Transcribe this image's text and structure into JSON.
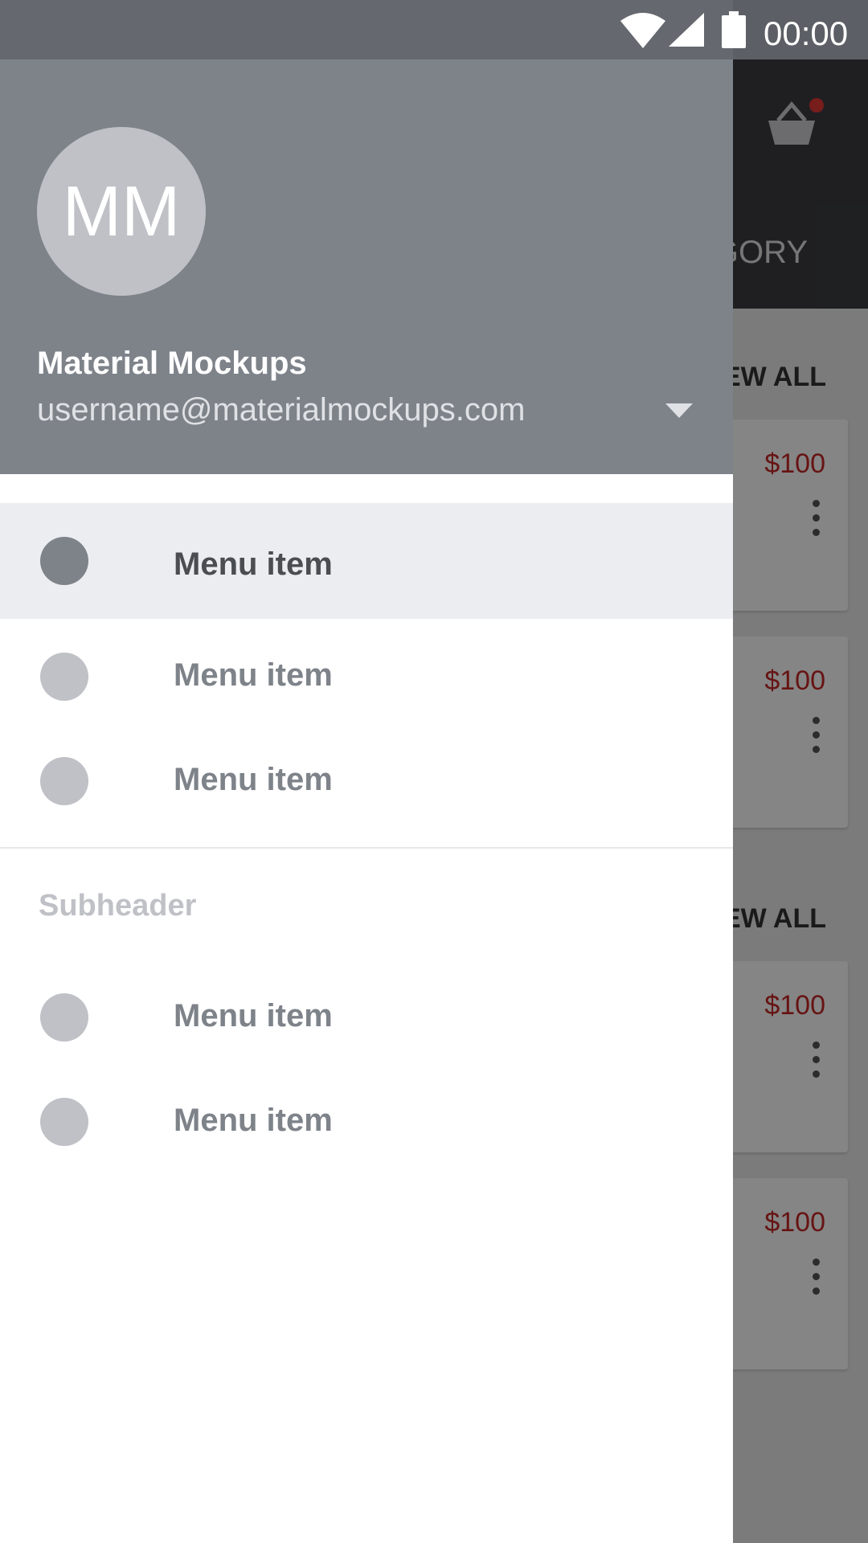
{
  "status_bar": {
    "time": "00:00",
    "icons": [
      "wifi-icon",
      "signal-icon",
      "battery-icon"
    ]
  },
  "drawer": {
    "avatar_initials": "MM",
    "account_name": "Material Mockups",
    "account_email": "username@materialmockups.com",
    "primary_items": [
      {
        "label": "Menu item",
        "icon": "circle-icon",
        "active": true
      },
      {
        "label": "Menu item",
        "icon": "circle-icon",
        "active": false
      },
      {
        "label": "Menu item",
        "icon": "circle-icon",
        "active": false
      }
    ],
    "subheader": "Subheader",
    "secondary_items": [
      {
        "label": "Menu item",
        "icon": "circle-icon"
      },
      {
        "label": "Menu item",
        "icon": "circle-icon"
      }
    ]
  },
  "background": {
    "tab_label": "GORY",
    "view_all_1": "EW ALL",
    "view_all_2": "EW ALL",
    "prices": [
      "$100",
      "$100",
      "$100",
      "$100"
    ]
  },
  "colors": {
    "header": "#7e838a",
    "accent": "#e53935",
    "price": "#c62828"
  }
}
